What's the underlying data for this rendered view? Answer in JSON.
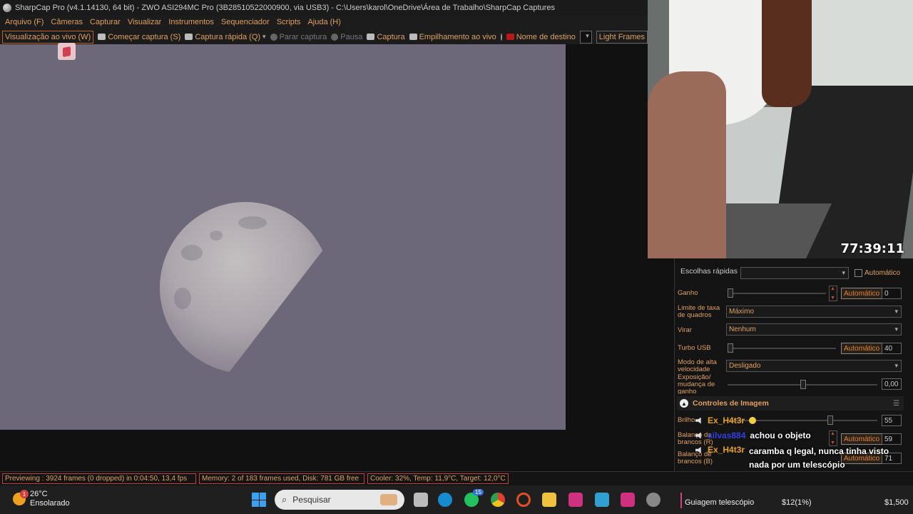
{
  "window": {
    "title": "SharpCap Pro (v4.1.14130, 64 bit) - ZWO ASI294MC Pro (3B28510522000900, via USB3) - C:\\Users\\karol\\OneDrive\\Área de Trabalho\\SharpCap Captures"
  },
  "menu": {
    "items": [
      "Arquivo (F)",
      "Câmeras",
      "Capturar",
      "Visualizar",
      "Instrumentos",
      "Sequenciador",
      "Scripts",
      "Ajuda (H)"
    ]
  },
  "toolbar": {
    "live_view": "Visualização ao vivo (W)",
    "start_capture": "Começar captura (S)",
    "quick_capture": "Captura rápida (Q)",
    "stop_capture": "Parar captura",
    "pause": "Pausa",
    "snapshot": "Captura",
    "live_stack": "Empilhamento ao vivo",
    "target_name": "Nome de destino",
    "target_value": "",
    "frame_type": "Light Frames"
  },
  "stream": {
    "timer": "77:39:11"
  },
  "camera_controls": {
    "quick_picks_label": "Escolhas rápidas",
    "quick_picks_value": "",
    "quick_picks_auto": "Automático",
    "gain_label": "Ganho",
    "gain_auto": "Automático",
    "gain_value": "0",
    "frame_rate_label": "Limite de taxa de quadros",
    "frame_rate_value": "Máximo",
    "flip_label": "Virar",
    "flip_value": "Nenhum",
    "usb_turbo_label": "Turbo USB",
    "usb_turbo_auto": "Automático",
    "usb_turbo_value": "40",
    "high_speed_label": "Modo de alta velocidade",
    "high_speed_value": "Desligado",
    "exposure_gain_label": "Exposição/ mudança de ganho",
    "exposure_gain_value": "0,00"
  },
  "image_controls": {
    "title": "Controles de Imagem",
    "brightness_label": "Brilho",
    "brightness_value": "55",
    "wb_red_label": "Balanço de brancos (R)",
    "wb_red_auto": "Automático",
    "wb_red_value": "59",
    "wb_blue_label": "Balanço de brancos (B)",
    "wb_blue_auto": "Automático",
    "wb_blue_value": "71"
  },
  "chat": [
    {
      "name": "Ex_H4t3r",
      "message": ""
    },
    {
      "name": "silvas884",
      "message": "achou o objeto"
    },
    {
      "name": "Ex_H4t3r",
      "message": "caramba q legal, nunca tinha visto nada por um telescópio"
    }
  ],
  "status": {
    "preview": "Previewing : 3924 frames (0 dropped) in 0:04:50, 13,4 fps",
    "memory": "Memory: 2 of 183 frames used, Disk: 781 GB free",
    "cooler": "Cooler: 32%, Temp: 11,9°C, Target: 12,0°C"
  },
  "taskbar": {
    "weather_temp": "26°C",
    "weather_desc": "Ensolarado",
    "weather_badge": "1",
    "search_placeholder": "Pesquisar",
    "whatsapp_badge": "15",
    "stream_goal": "Guiagem telescópio",
    "goal_amount": "$12(1%)",
    "goal_target": "$1,500"
  },
  "colors": {
    "accent": "#e0a060",
    "viewport_bg": "#6d677a",
    "status_border": "#c04040"
  }
}
